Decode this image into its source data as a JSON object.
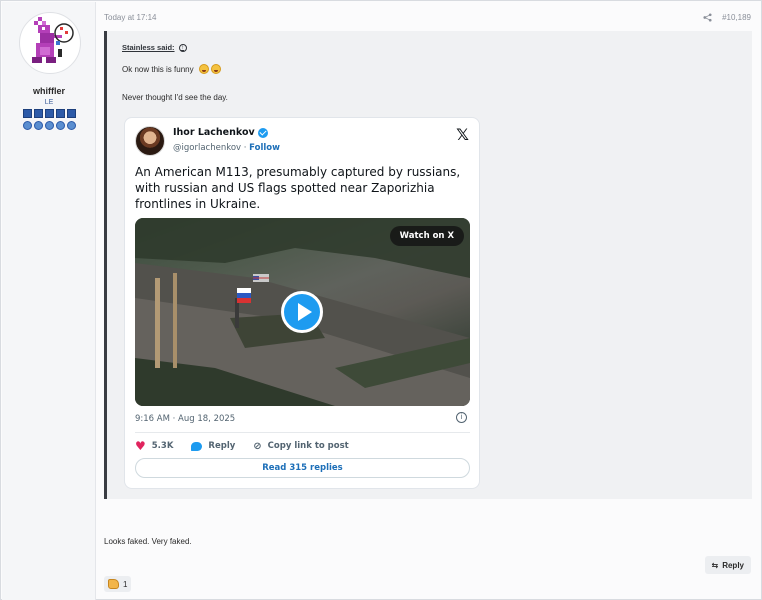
{
  "user": {
    "name": "whiffler",
    "title": "LE"
  },
  "post": {
    "time": "Today at 17:14",
    "number": "#10,189",
    "body": "Looks faked. Very faked.",
    "reply_label": "Reply",
    "reaction_count": "1"
  },
  "quote": {
    "author": "Stainless said:",
    "line1": "Ok now this is funny",
    "line2": "Never thought I'd see the day."
  },
  "tweet": {
    "name": "Ihor Lachenkov",
    "handle": "@igorlachenkov",
    "separator": " · ",
    "follow": "Follow",
    "x_logo": "𝕏",
    "text": "An American M113, presumably captured by russians, with russian and US flags spotted near Zaporizhia frontlines in Ukraine.",
    "watch_label": "Watch on X",
    "date": "9:16 AM · Aug 18, 2025",
    "likes": "5.3K",
    "reply_label": "Reply",
    "copy_link_label": "Copy link to post",
    "read_replies": "Read 315 replies"
  },
  "colors": {
    "accent_blue": "#1d9bf0",
    "link_blue": "#1d6fb8",
    "heart_pink": "#e0245e"
  }
}
